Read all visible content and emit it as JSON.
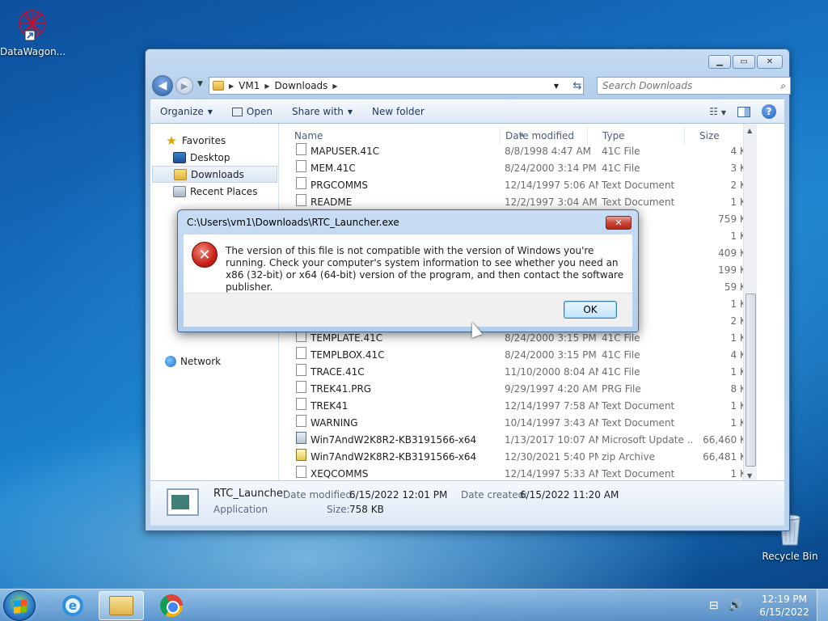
{
  "desktop": {
    "icons": [
      {
        "label": "DataWagon..."
      },
      {
        "label": "Recycle Bin"
      }
    ]
  },
  "explorer": {
    "breadcrumb": [
      "VM1",
      "Downloads"
    ],
    "search_placeholder": "Search Downloads",
    "toolbar": {
      "organize": "Organize",
      "open": "Open",
      "share_with": "Share with",
      "new_folder": "New folder"
    },
    "nav": {
      "favorites": "Favorites",
      "desktop": "Desktop",
      "downloads": "Downloads",
      "recent_places": "Recent Places",
      "network": "Network"
    },
    "columns": {
      "name": "Name",
      "date_modified": "Date modified",
      "type": "Type",
      "size": "Size"
    },
    "rows": [
      {
        "name": "MAPUSER.41C",
        "date": "8/8/1998 4:47 AM",
        "type": "41C File",
        "size": "4 KB",
        "icon": "file"
      },
      {
        "name": "MEM.41C",
        "date": "8/24/2000 3:14 PM",
        "type": "41C File",
        "size": "3 KB",
        "icon": "file"
      },
      {
        "name": "PRGCOMMS",
        "date": "12/14/1997 5:06 AM",
        "type": "Text Document",
        "size": "2 KB",
        "icon": "file"
      },
      {
        "name": "README",
        "date": "12/2/1997 3:04 AM",
        "type": "Text Document",
        "size": "1 KB",
        "icon": "file"
      },
      {
        "name": "",
        "date": "",
        "type": "ion",
        "size": "759 KB",
        "icon": ""
      },
      {
        "name": "",
        "date": "",
        "type": "",
        "size": "1 KB",
        "icon": ""
      },
      {
        "name": "",
        "date": "",
        "type": "ion",
        "size": "409 KB",
        "icon": ""
      },
      {
        "name": "",
        "date": "",
        "type": "ive",
        "size": "199 KB",
        "icon": ""
      },
      {
        "name": "",
        "date": "",
        "type": "",
        "size": "59 KB",
        "icon": ""
      },
      {
        "name": "",
        "date": "",
        "type": "",
        "size": "1 KB",
        "icon": ""
      },
      {
        "name": "",
        "date": "",
        "type": "",
        "size": "2 KB",
        "icon": ""
      },
      {
        "name": "TEMPLATE.41C",
        "date": "8/24/2000 3:15 PM",
        "type": "41C File",
        "size": "1 KB",
        "icon": "file"
      },
      {
        "name": "TEMPLBOX.41C",
        "date": "8/24/2000 3:15 PM",
        "type": "41C File",
        "size": "4 KB",
        "icon": "file"
      },
      {
        "name": "TRACE.41C",
        "date": "11/10/2000 8:04 AM",
        "type": "41C File",
        "size": "1 KB",
        "icon": "file"
      },
      {
        "name": "TREK41.PRG",
        "date": "9/29/1997 4:20 AM",
        "type": "PRG File",
        "size": "8 KB",
        "icon": "file"
      },
      {
        "name": "TREK41",
        "date": "12/14/1997 7:58 AM",
        "type": "Text Document",
        "size": "1 KB",
        "icon": "file"
      },
      {
        "name": "WARNING",
        "date": "10/14/1997 3:43 AM",
        "type": "Text Document",
        "size": "1 KB",
        "icon": "file"
      },
      {
        "name": "Win7AndW2K8R2-KB3191566-x64",
        "date": "1/13/2017 10:07 AM",
        "type": "Microsoft Update ...",
        "size": "66,460 KB",
        "icon": "setup"
      },
      {
        "name": "Win7AndW2K8R2-KB3191566-x64",
        "date": "12/30/2021 5:40 PM",
        "type": "zip Archive",
        "size": "66,481 KB",
        "icon": "zip"
      },
      {
        "name": "XEQCOMMS",
        "date": "12/14/1997 5:33 AM",
        "type": "Text Document",
        "size": "1 KB",
        "icon": "file"
      }
    ],
    "details": {
      "name": "RTC_Launcher",
      "kind": "Application",
      "modified_label": "Date modified:",
      "modified_value": "6/15/2022 12:01 PM",
      "created_label": "Date created:",
      "created_value": "6/15/2022 11:20 AM",
      "size_label": "Size:",
      "size_value": "758 KB"
    }
  },
  "dialog": {
    "title": "C:\\Users\\vm1\\Downloads\\RTC_Launcher.exe",
    "message": "The version of this file is not compatible with the version of Windows you're running. Check your computer's system information to see whether you need an x86 (32-bit) or x64 (64-bit) version of the program, and then contact the software publisher.",
    "ok_label": "OK"
  },
  "taskbar": {
    "time": "12:19 PM",
    "date": "6/15/2022"
  }
}
